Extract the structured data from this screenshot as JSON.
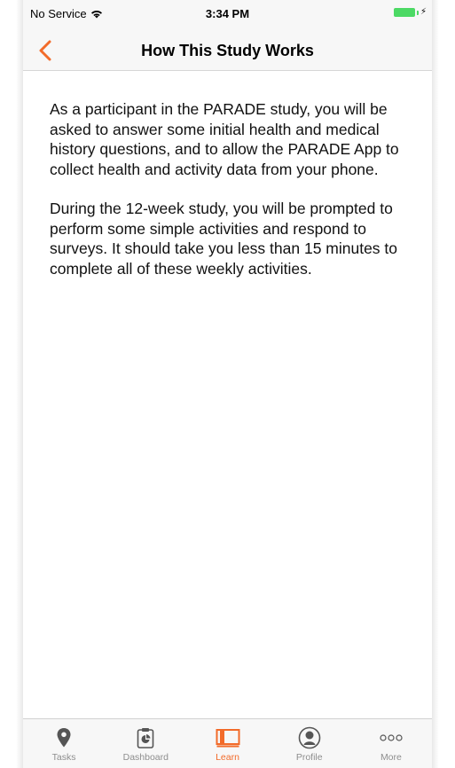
{
  "status_bar": {
    "carrier": "No Service",
    "time": "3:34 PM"
  },
  "nav": {
    "title": "How This Study Works",
    "back_icon": "chevron-left-icon"
  },
  "content": {
    "paragraphs": [
      "As a participant in the PARADE study, you will be asked to answer some initial health and medical history questions, and to allow the PARADE App to collect health and activity data from your phone.",
      "During the 12-week study, you will be prompted to perform some simple activities and respond to surveys. It should take you less than 15 minutes to complete all of these weekly activities."
    ]
  },
  "tabs": [
    {
      "label": "Tasks",
      "icon": "map-pin-icon",
      "active": false
    },
    {
      "label": "Dashboard",
      "icon": "clipboard-chart-icon",
      "active": false
    },
    {
      "label": "Learn",
      "icon": "book-icon",
      "active": true
    },
    {
      "label": "Profile",
      "icon": "person-icon",
      "active": false
    },
    {
      "label": "More",
      "icon": "more-icon",
      "active": false
    }
  ],
  "colors": {
    "accent": "#f26b2a",
    "battery": "#4cd964",
    "inactive": "#8e8e8e"
  }
}
